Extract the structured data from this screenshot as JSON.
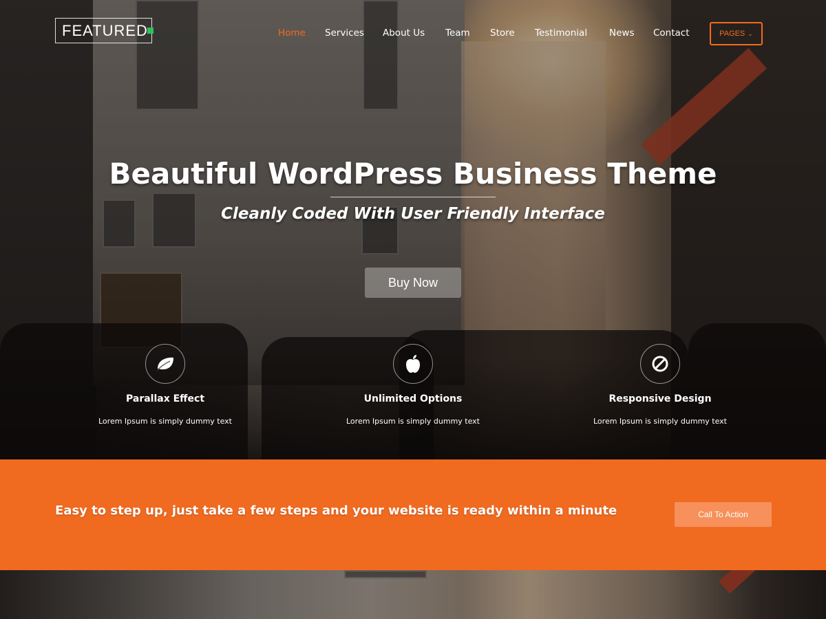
{
  "header": {
    "logo_text": "FEATURED",
    "nav": [
      {
        "label": "Home",
        "active": true
      },
      {
        "label": "Services",
        "active": false
      },
      {
        "label": "About Us",
        "active": false
      },
      {
        "label": "Team",
        "active": false
      },
      {
        "label": "Store",
        "active": false
      },
      {
        "label": "Testimonial",
        "active": false
      },
      {
        "label": "News",
        "active": false
      },
      {
        "label": "Contact",
        "active": false
      }
    ],
    "pages_button": "PAGES"
  },
  "hero": {
    "title": "Beautiful WordPress Business Theme",
    "subtitle": "Cleanly Coded With User Friendly Interface",
    "button_label": "Buy Now"
  },
  "features": [
    {
      "icon": "leaf-icon",
      "title": "Parallax Effect",
      "text": "Lorem Ipsum is simply dummy text"
    },
    {
      "icon": "apple-icon",
      "title": "Unlimited Options",
      "text": "Lorem Ipsum is simply dummy text"
    },
    {
      "icon": "ban-icon",
      "title": "Responsive Design",
      "text": "Lorem Ipsum is simply dummy text"
    }
  ],
  "cta": {
    "text": "Easy to step up, just take a few steps and your website is ready within a minute",
    "button_label": "Call To Action"
  },
  "colors": {
    "accent": "#f06a20",
    "logo_dot": "#2ec25a"
  }
}
